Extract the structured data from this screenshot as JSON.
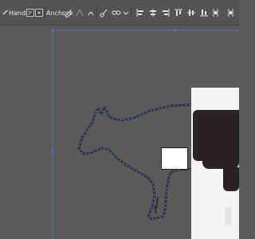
{
  "control_bar": {
    "handles_label": "Handles:",
    "anchors_label": "Anchors:",
    "icons": [
      "pen-tool-icon",
      "convert-anchor-icon",
      "remove-handles-icon",
      "cut-path-icon",
      "link-icon",
      "align-options-icon",
      "align-left-icon",
      "align-center-icon",
      "align-right-icon",
      "align-top-icon",
      "align-middle-icon",
      "align-bottom-icon",
      "distribute-icon"
    ]
  },
  "colors": {
    "canvas_bg": "#5a5a5a",
    "toolbar_bg": "#535353",
    "artboard_edge": "#5d6db8",
    "path_stroke": "#1e2a40"
  }
}
